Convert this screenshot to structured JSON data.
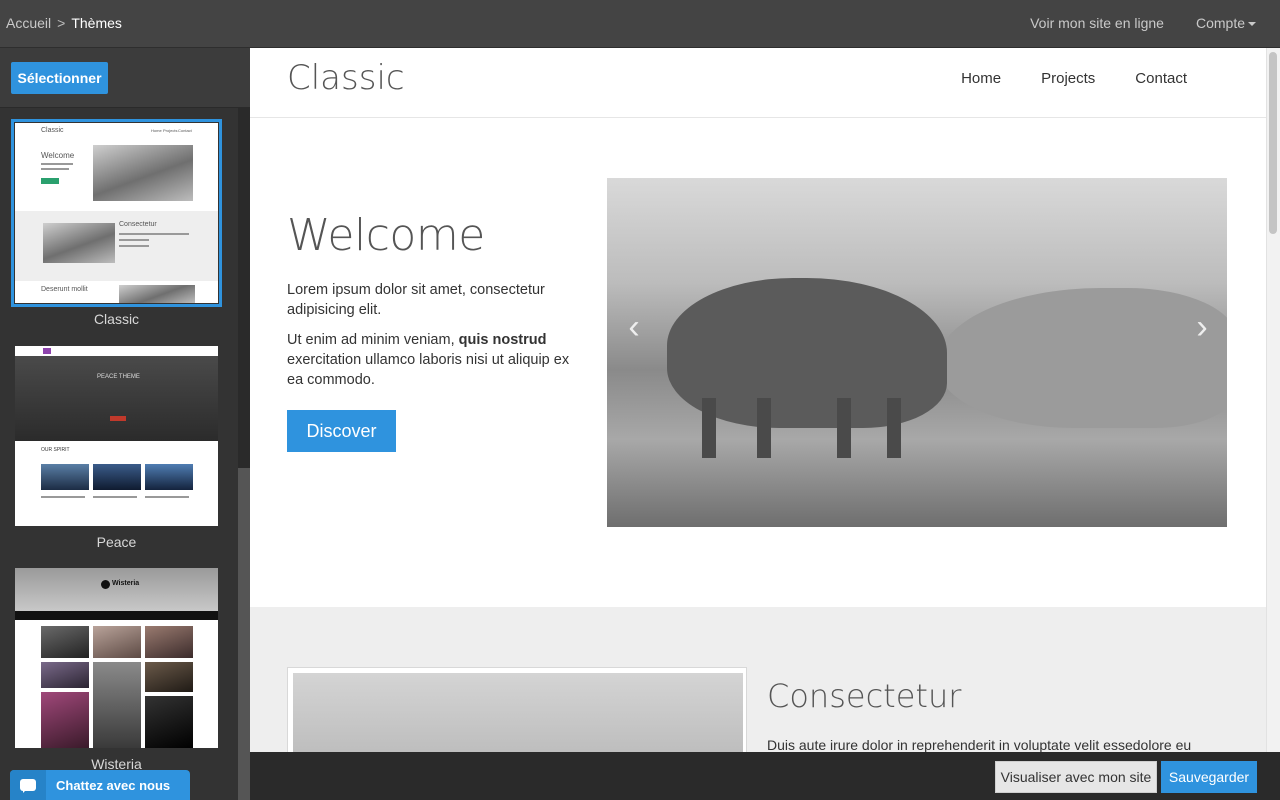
{
  "topbar": {
    "breadcrumb_home": "Accueil",
    "breadcrumb_separator": ">",
    "breadcrumb_current": "Thèmes",
    "view_site": "Voir mon site en ligne",
    "account": "Compte"
  },
  "sidebar": {
    "select_button": "Sélectionner",
    "themes": [
      {
        "name": "Classic",
        "thumb_title": "Classic",
        "thumb_nav": [
          "Home",
          "Projects",
          "Contact"
        ],
        "thumb_heading_1": "Welcome",
        "thumb_heading_2": "Consectetur",
        "thumb_heading_3": "Deserunt mollit"
      },
      {
        "name": "Peace",
        "thumb_title": "PEACE THEME",
        "thumb_section": "OUR SPIRIT"
      },
      {
        "name": "Wisteria",
        "thumb_title": "Wisteria"
      }
    ]
  },
  "preview": {
    "site_title": "Classic",
    "nav": [
      "Home",
      "Projects",
      "Contact"
    ],
    "welcome_heading": "Welcome",
    "para1": "Lorem ipsum dolor sit amet, consectetur adipisicing elit.",
    "para2_start": "Ut enim ad minim veniam, ",
    "para2_bold": "quis nostrud",
    "para2_end": " exercitation ullamco laboris nisi ut aliquip ex ea commodo.",
    "discover_button": "Discover",
    "prev_arrow": "‹",
    "next_arrow": "›",
    "section2_heading": "Consectetur",
    "section2_text": "Duis aute irure dolor in reprehenderit in voluptate velit essedolore eu"
  },
  "bottombar": {
    "preview_button": "Visualiser avec mon site",
    "save_button": "Sauvegarder"
  },
  "chat": {
    "label": "Chattez avec nous"
  },
  "colors": {
    "accent": "#2f93de",
    "topbar": "#444444",
    "sidebar": "#333333",
    "bottombar": "#2a2a2a"
  }
}
